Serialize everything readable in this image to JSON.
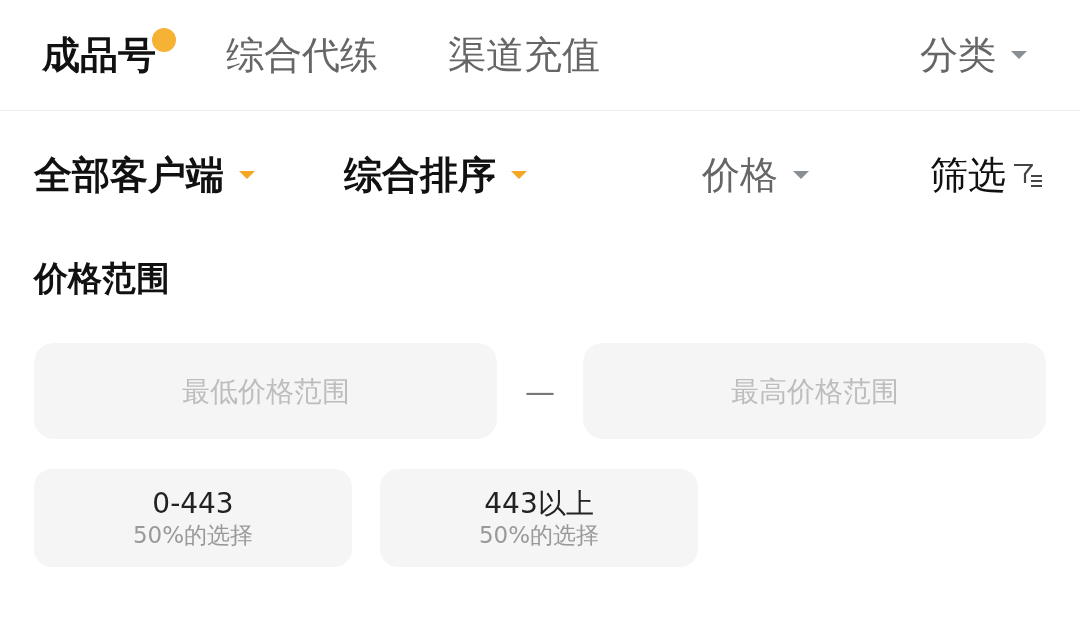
{
  "tabs": [
    {
      "label": "成品号",
      "selected": true
    },
    {
      "label": "综合代练",
      "selected": false
    },
    {
      "label": "渠道充值",
      "selected": false
    }
  ],
  "category": {
    "label": "分类"
  },
  "sort_options": [
    {
      "label": "全部客户端",
      "active": true
    },
    {
      "label": "综合排序",
      "active": true
    },
    {
      "label": "价格",
      "active": false
    }
  ],
  "filter": {
    "label": "筛选"
  },
  "price_range": {
    "title": "价格范围",
    "min": {
      "placeholder": "最低价格范围"
    },
    "separator": "—",
    "max": {
      "placeholder": "最高价格范围"
    },
    "presets": [
      {
        "range": "0-443",
        "share": "50%的选择"
      },
      {
        "range": "443以上",
        "share": "50%的选择"
      }
    ]
  }
}
